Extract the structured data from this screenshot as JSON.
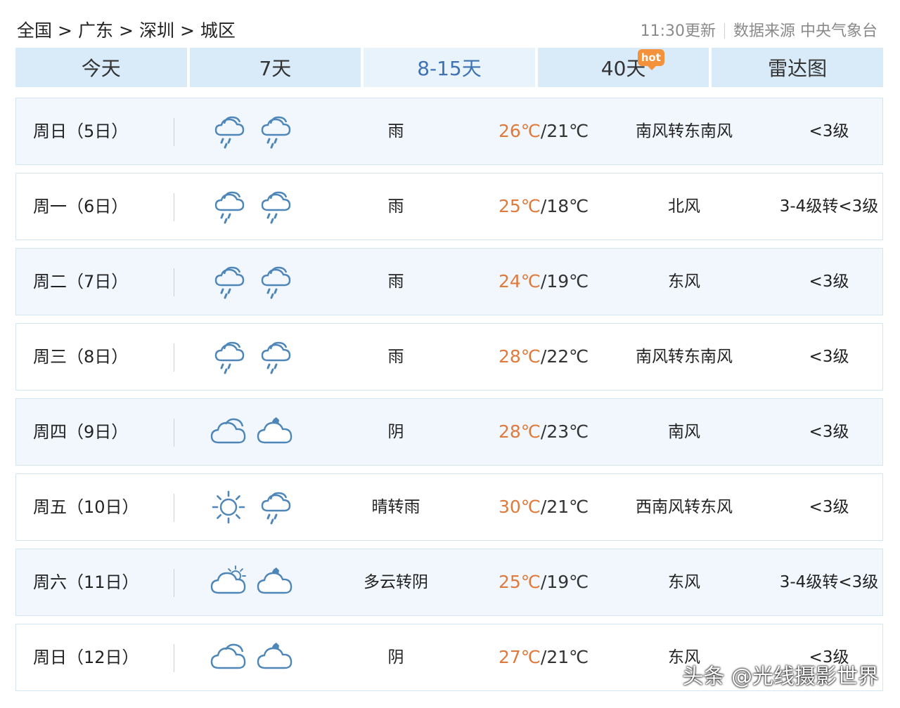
{
  "breadcrumb": {
    "items": [
      "全国",
      "广东",
      "深圳",
      "城区"
    ],
    "separator": ">"
  },
  "meta": {
    "update_time": "11:30更新",
    "source": "数据来源 中央气象台"
  },
  "tabs": [
    {
      "label": "今天",
      "active": false
    },
    {
      "label": "7天",
      "active": false
    },
    {
      "label": "8-15天",
      "active": true
    },
    {
      "label": "40天",
      "active": false,
      "badge": "hot"
    },
    {
      "label": "雷达图",
      "active": false
    }
  ],
  "forecast": [
    {
      "day": "周日（5日）",
      "icon_day": "rain-cloud-icon",
      "icon_night": "rain-cloud-icon",
      "desc": "雨",
      "high": "26℃",
      "low": "21℃",
      "wind": "南风转东南风",
      "level": "<3级"
    },
    {
      "day": "周一（6日）",
      "icon_day": "rain-cloud-icon",
      "icon_night": "rain-cloud-icon",
      "desc": "雨",
      "high": "25℃",
      "low": "18℃",
      "wind": "北风",
      "level": "3-4级转<3级"
    },
    {
      "day": "周二（7日）",
      "icon_day": "rain-cloud-icon",
      "icon_night": "rain-cloud-icon",
      "desc": "雨",
      "high": "24℃",
      "low": "19℃",
      "wind": "东风",
      "level": "<3级"
    },
    {
      "day": "周三（8日）",
      "icon_day": "rain-cloud-icon",
      "icon_night": "rain-cloud-icon",
      "desc": "雨",
      "high": "28℃",
      "low": "22℃",
      "wind": "南风转东南风",
      "level": "<3级"
    },
    {
      "day": "周四（9日）",
      "icon_day": "cloud-icon",
      "icon_night": "moon-cloud-icon",
      "desc": "阴",
      "high": "28℃",
      "low": "23℃",
      "wind": "南风",
      "level": "<3级"
    },
    {
      "day": "周五（10日）",
      "icon_day": "sun-icon",
      "icon_night": "rain-cloud-icon",
      "desc": "晴转雨",
      "high": "30℃",
      "low": "21℃",
      "wind": "西南风转东风",
      "level": "<3级"
    },
    {
      "day": "周六（11日）",
      "icon_day": "sun-cloud-icon",
      "icon_night": "moon-cloud-icon",
      "desc": "多云转阴",
      "high": "25℃",
      "low": "19℃",
      "wind": "东风",
      "level": "3-4级转<3级"
    },
    {
      "day": "周日（12日）",
      "icon_day": "cloud-icon",
      "icon_night": "moon-cloud-icon",
      "desc": "阴",
      "high": "27℃",
      "low": "21℃",
      "wind": "东风",
      "level": "<3级"
    }
  ],
  "watermark": "头条 @光线摄影世界",
  "colors": {
    "tab_bg": "#d9eaf9",
    "tab_active_text": "#3f72b3",
    "temp_high": "#e07a3c",
    "row_border": "#d5e6f3",
    "icon_stroke": "#4f86b8",
    "hot_badge": "#f3923a"
  }
}
